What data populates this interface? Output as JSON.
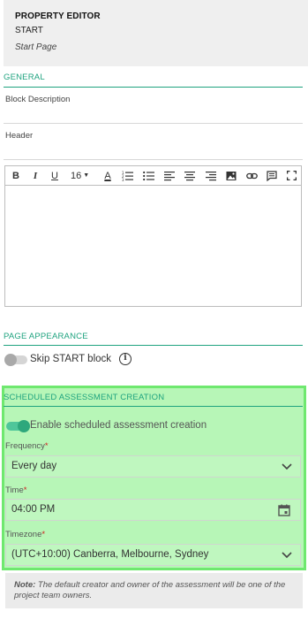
{
  "property_editor": {
    "title": "PROPERTY EDITOR",
    "block_name": "START",
    "page_name": "Start Page"
  },
  "general": {
    "section_title": "GENERAL",
    "block_description_label": "Block Description",
    "header_label": "Header"
  },
  "editor_toolbar": {
    "bold": "B",
    "italic": "I",
    "underline": "U",
    "font_size": "16",
    "font_color": "A",
    "icons": [
      "ordered-list-icon",
      "bullet-list-icon",
      "align-left-icon",
      "align-center-icon",
      "align-right-icon",
      "image-icon",
      "link-icon",
      "comment-icon",
      "fullscreen-icon"
    ]
  },
  "page_appearance": {
    "section_title": "PAGE APPEARANCE",
    "skip_start_label": "Skip START block",
    "skip_start_enabled": false
  },
  "scheduled": {
    "section_title": "SCHEDULED ASSESSMENT CREATION",
    "enable_label": "Enable scheduled assessment creation",
    "enabled": true,
    "frequency_label": "Frequency",
    "frequency_value": "Every day",
    "time_label": "Time",
    "time_value": "04:00 PM",
    "timezone_label": "Timezone",
    "timezone_value": "(UTC+10:00) Canberra, Melbourne, Sydney",
    "required_mark": "*"
  },
  "note": {
    "label": "Note:",
    "text": " The default creator and owner of the assessment will be one of the project team owners."
  },
  "colors": {
    "accent": "#1fa37f",
    "highlight": "#6fe86f"
  }
}
